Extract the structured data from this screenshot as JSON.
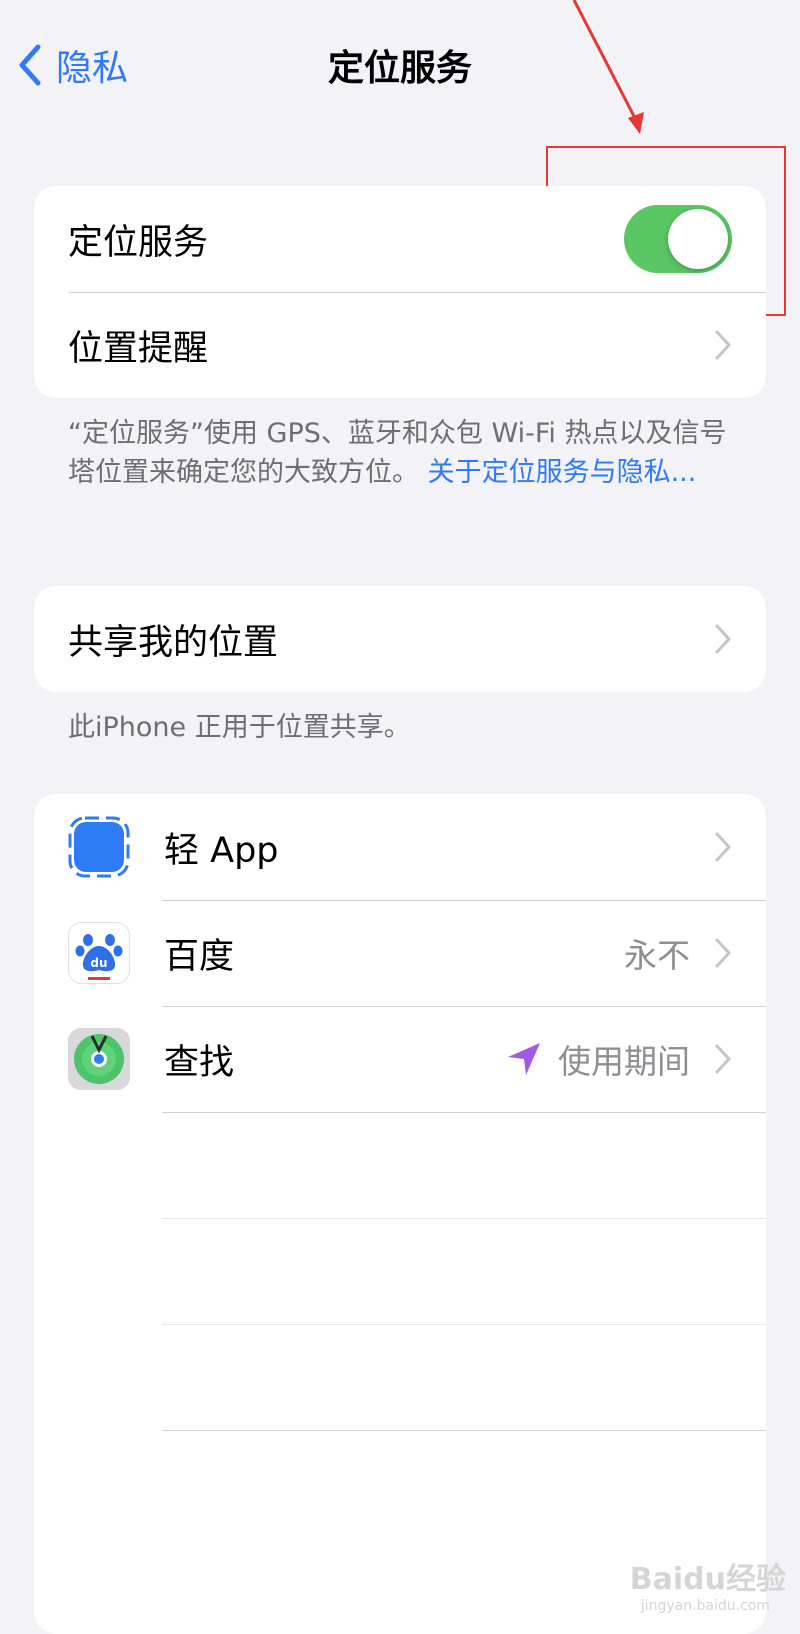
{
  "nav": {
    "back_label": "隐私",
    "title": "定位服务"
  },
  "section1": {
    "location_services_label": "定位服务",
    "location_services_on": true,
    "location_alerts_label": "位置提醒"
  },
  "footer1": {
    "text": "“定位服务”使用 GPS、蓝牙和众包 Wi-Fi 热点以及信号塔位置来确定您的大致方位。",
    "link": "关于定位服务与隐私..."
  },
  "section2": {
    "share_my_location_label": "共享我的位置"
  },
  "footer2": {
    "text": "此iPhone 正用于位置共享。"
  },
  "apps": [
    {
      "name": "轻 App",
      "value": "",
      "icon": "app-clip-icon"
    },
    {
      "name": "百度",
      "value": "永不",
      "icon": "baidu-icon"
    },
    {
      "name": "查找",
      "value": "使用期间",
      "icon": "find-my-icon",
      "indicator": "location-arrow-icon"
    }
  ],
  "watermark": {
    "brand": "Baidu经验",
    "url": "jingyan.baidu.com"
  },
  "colors": {
    "accent": "#2f7bf5",
    "toggle_on": "#5ac664",
    "annotation": "#e53935",
    "location_arrow": "#a259e6"
  }
}
